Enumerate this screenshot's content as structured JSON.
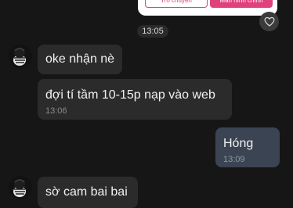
{
  "top_card": {
    "chat_button_label": "Trò chuyện",
    "home_button_label": "Màn hình chính"
  },
  "date_separator": "13:05",
  "messages": [
    {
      "direction": "incoming",
      "text": "oke nhận nè",
      "time": ""
    },
    {
      "direction": "incoming",
      "text": "đợi tí tầm 10-15p nạp vào web",
      "time": "13:06"
    },
    {
      "direction": "outgoing",
      "text": "Hóng",
      "time": "13:09"
    },
    {
      "direction": "incoming",
      "text": "sờ cam bai bai",
      "time": ""
    }
  ],
  "colors": {
    "background": "#161616",
    "incoming_bubble": "#2b2b2b",
    "outgoing_bubble": "#3b4452",
    "accent": "#e0417c"
  },
  "icons": [
    "heart-icon",
    "avatar"
  ]
}
